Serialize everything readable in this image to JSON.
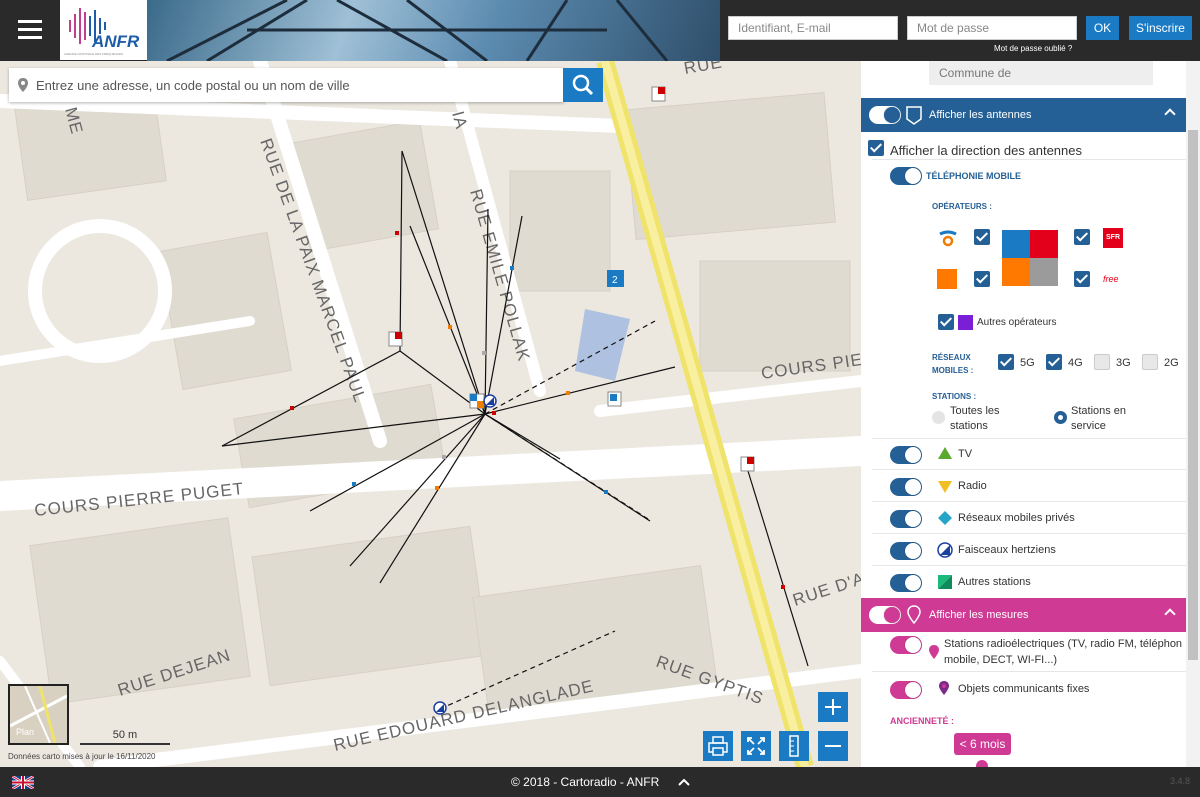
{
  "header": {
    "logo": "ANFR",
    "logo_subtitle": "AGENCE NATIONALE DES FRÉQUENCES",
    "login_placeholder": "Identifiant, E-mail",
    "password_placeholder": "Mot de passe",
    "ok_label": "OK",
    "signup_label": "S'inscrire",
    "forgot_label": "Mot de passe oublié ?"
  },
  "search": {
    "placeholder": "Entrez une adresse, un code postal ou un nom de ville"
  },
  "map": {
    "streets": [
      "RUE DE LA PAIX MARCEL PAUL",
      "RUE EMILE POLLAK",
      "COURS PIERRE PUGET",
      "RUE DEJEAN",
      "RUE EDOUARD DELANGLADE",
      "RUE GYPTIS",
      "COURS PIE",
      "RUE D'A",
      "RUE",
      "ME",
      "IA"
    ],
    "cluster_count": "2",
    "plan_label": "Plan",
    "scale_label": "50 m",
    "data_note": "Données carto mises à jour le 16/11/2020"
  },
  "panel": {
    "commune_placeholder": "Commune de",
    "antennas_section": "Afficher les antennes",
    "direction_label": "Afficher la direction des antennes",
    "mobile_label": "TÉLÉPHONIE MOBILE",
    "operators_label": "OPÉRATEURS :",
    "operators": [
      "Bouygues",
      "Orange",
      "SFR",
      "free"
    ],
    "other_operators": "Autres opérateurs",
    "networks_label_1": "RÉSEAUX",
    "networks_label_2": "MOBILES :",
    "networks": [
      "5G",
      "4G",
      "3G",
      "2G"
    ],
    "stations_label": "STATIONS :",
    "all_stations": "Toutes les stations",
    "all_stations_1": "Toutes les",
    "all_stations_2": "stations",
    "in_service_1": "Stations en",
    "in_service_2": "service",
    "layers": [
      "TV",
      "Radio",
      "Réseaux mobiles privés",
      "Faisceaux hertziens",
      "Autres stations"
    ],
    "measures_section": "Afficher les mesures",
    "measure_1a": "Stations radioélectriques (TV, radio FM, téléphon",
    "measure_1b": "mobile, DECT, WI-FI...)",
    "measure_2": "Objets communicants fixes",
    "age_label": "ANCIENNETÉ :",
    "age_badge": "< 6 mois"
  },
  "footer": {
    "copyright": "© 2018 - Cartoradio - ANFR",
    "version": "3.4.8"
  },
  "colors": {
    "primary": "#1a7bc4",
    "section_blue": "#245f95",
    "section_pink": "#cf3a95",
    "header_bg": "#2a2a2a"
  },
  "icons": [
    "hamburger-icon",
    "pin-icon",
    "search-icon",
    "print-icon",
    "fullscreen-icon",
    "ruler-icon",
    "plus-icon",
    "minus-icon",
    "chevron-up-icon",
    "flag-uk-icon"
  ]
}
